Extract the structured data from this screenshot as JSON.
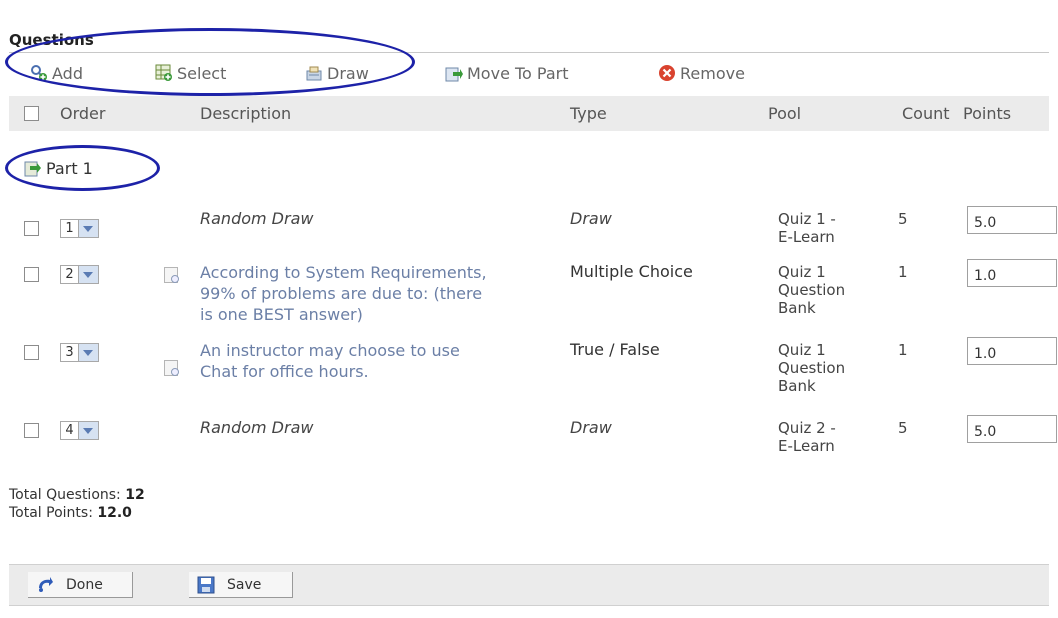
{
  "section": {
    "title": "Questions"
  },
  "toolbar": {
    "items": [
      {
        "label": "Add",
        "icon": "add-question-icon"
      },
      {
        "label": "Select",
        "icon": "select-grid-icon"
      },
      {
        "label": "Draw",
        "icon": "draw-icon"
      },
      {
        "label": "Move To Part",
        "icon": "move-to-part-icon"
      },
      {
        "label": "Remove",
        "icon": "remove-icon"
      }
    ]
  },
  "table": {
    "headers": {
      "order": "Order",
      "description": "Description",
      "type": "Type",
      "pool": "Pool",
      "count": "Count",
      "points": "Points"
    },
    "part": {
      "label": "Part 1",
      "icon": "part-icon"
    },
    "rows": [
      {
        "order": "1",
        "description": "Random Draw",
        "type": "Draw",
        "pool": [
          "Quiz 1 -",
          "E-Learn"
        ],
        "count": "5",
        "points": "5.0"
      },
      {
        "order": "2",
        "description": [
          "According to System Requirements,",
          "99% of problems are due to: (there",
          "is one BEST answer)"
        ],
        "type": "Multiple Choice",
        "pool": [
          "Quiz 1",
          "Question",
          "Bank"
        ],
        "count": "1",
        "points": "1.0"
      },
      {
        "order": "3",
        "description": [
          "An instructor may choose to use",
          "Chat for office hours."
        ],
        "type": "True / False",
        "pool": [
          "Quiz 1",
          "Question",
          "Bank"
        ],
        "count": "1",
        "points": "1.0"
      },
      {
        "order": "4",
        "description": "Random Draw",
        "type": "Draw",
        "pool": [
          "Quiz 2 -",
          "E-Learn"
        ],
        "count": "5",
        "points": "5.0"
      }
    ]
  },
  "totals": {
    "questions_label": "Total Questions:",
    "questions_value": "12",
    "points_label": "Total Points:",
    "points_value": "12.0"
  },
  "footer": {
    "done_label": "Done",
    "done_icon": "done-icon",
    "save_label": "Save",
    "save_icon": "save-icon"
  },
  "colors": {
    "annotation": "#1d22a8",
    "link": "#6b7fa6",
    "header_bg": "#ebebeb",
    "remove_red": "#d9432f"
  }
}
